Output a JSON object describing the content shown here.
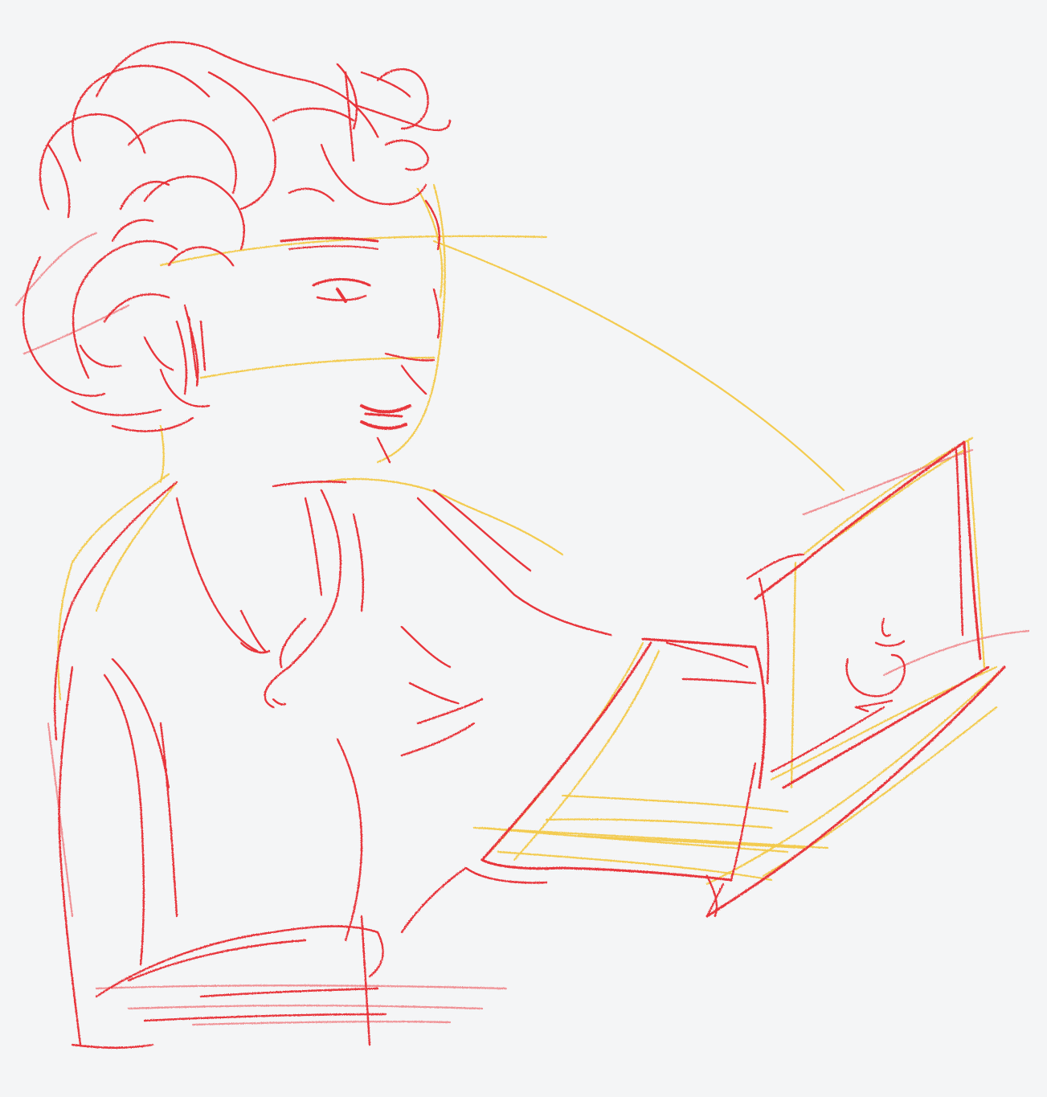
{
  "artwork": {
    "paper_color": "#f4f5f6",
    "colors": {
      "red_pencil": "#e8343b",
      "pink_pencil": "#ef6f74",
      "yellow_pencil": "#f3c430"
    }
  }
}
